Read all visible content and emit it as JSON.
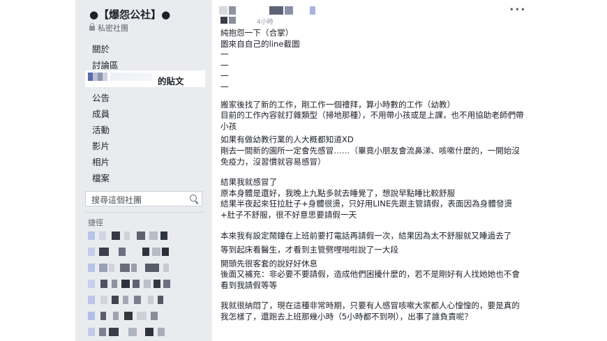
{
  "sidebar": {
    "group_name": "●【爆怨公社】●",
    "privacy": "私密社團",
    "nav": [
      {
        "label": "關於"
      },
      {
        "label": "討論區"
      },
      {
        "label": "的貼文"
      },
      {
        "label": "公告"
      },
      {
        "label": "成員"
      },
      {
        "label": "活動"
      },
      {
        "label": "影片"
      },
      {
        "label": "相片"
      },
      {
        "label": "檔案"
      }
    ],
    "search_placeholder": "搜尋這個社團",
    "shortcuts_label": "捷徑"
  },
  "post": {
    "time": "4小時",
    "more": "•••",
    "paragraphs": [
      "純抱怨一下（合掌）\n圖來自自己的line截圖\n一\n一\n一\n一",
      "搬家後找了新的工作，剛工作一個禮拜，算小時數的工作（幼教）\n目前的工作內容就打雜類型（掃地那種），不用帶小孩或是上課，也不用協助老師們帶小孩",
      "如果有做幼教行業的人大概都知道XD\n剛去一間新的園所一定會先感冒……（畢竟小朋友會流鼻涕、咳嗽什麼的，一開始沒免疫力，沒習慣就容易感冒）",
      "結果我就感冒了\n原本身體是還好，我晚上九點多就去睡覺了，想說早點睡比較舒服\n結果半夜起來狂拉肚子+身體很燙，只好用LINE先跟主管請假，表面因為身體發燙+肚子不舒服，很不好意思要請假一天",
      "本來我有設定鬧鐘在上班前要打電話再請假一次，結果因為太不舒服就又睡過去了",
      "等到起床看醫生，才看到主管劈哩啪啦說了一大段",
      "開頭先很客套的說好好休息\n後面又補充：非必要不要請假，造成他們困擾什麼的，若不是剛好有人找她她也不會看到我請假等等",
      "我就很納悶了，現在這種非常時期，只要有人感冒咳嗽大家都人心惶惶的，要是真的我怎樣了，還跑去上班那幾小時（5小時都不到咧），出事了誰負責呢？"
    ]
  }
}
